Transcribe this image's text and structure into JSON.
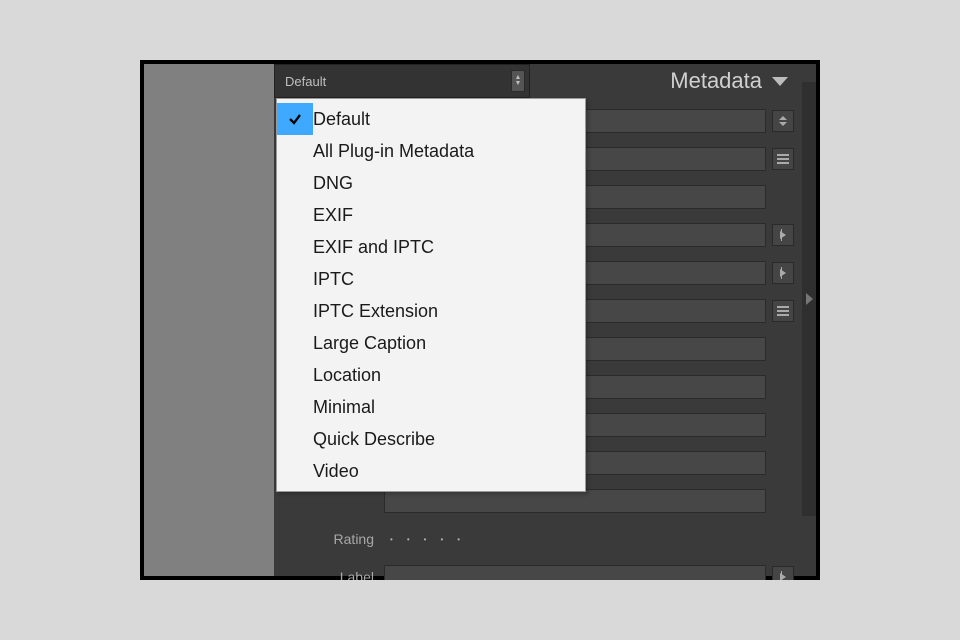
{
  "header": {
    "preset_selected": "Default",
    "panel_title": "Metadata"
  },
  "menu": {
    "items": [
      {
        "label": "Default",
        "selected": true
      },
      {
        "label": "All Plug-in Metadata",
        "selected": false
      },
      {
        "label": "DNG",
        "selected": false
      },
      {
        "label": "EXIF",
        "selected": false
      },
      {
        "label": "EXIF and IPTC",
        "selected": false
      },
      {
        "label": "IPTC",
        "selected": false
      },
      {
        "label": "IPTC Extension",
        "selected": false
      },
      {
        "label": "Large Caption",
        "selected": false
      },
      {
        "label": "Location",
        "selected": false
      },
      {
        "label": "Minimal",
        "selected": false
      },
      {
        "label": "Quick Describe",
        "selected": false
      },
      {
        "label": "Video",
        "selected": false
      }
    ]
  },
  "rows": [
    {
      "label": "",
      "side": "stepper"
    },
    {
      "label": "",
      "side": "lines"
    },
    {
      "label": "",
      "side": "none"
    },
    {
      "label": "",
      "side": "arrow"
    },
    {
      "label": "",
      "side": "arrow"
    },
    {
      "label": "",
      "side": "lines"
    },
    {
      "label": "",
      "side": "none"
    },
    {
      "label": "",
      "side": "none"
    },
    {
      "label": "",
      "side": "none"
    },
    {
      "label": "",
      "side": "none"
    },
    {
      "label": "",
      "side": "none"
    },
    {
      "label": "Rating",
      "side": "none",
      "type": "rating"
    },
    {
      "label": "Label",
      "side": "arrow"
    }
  ]
}
